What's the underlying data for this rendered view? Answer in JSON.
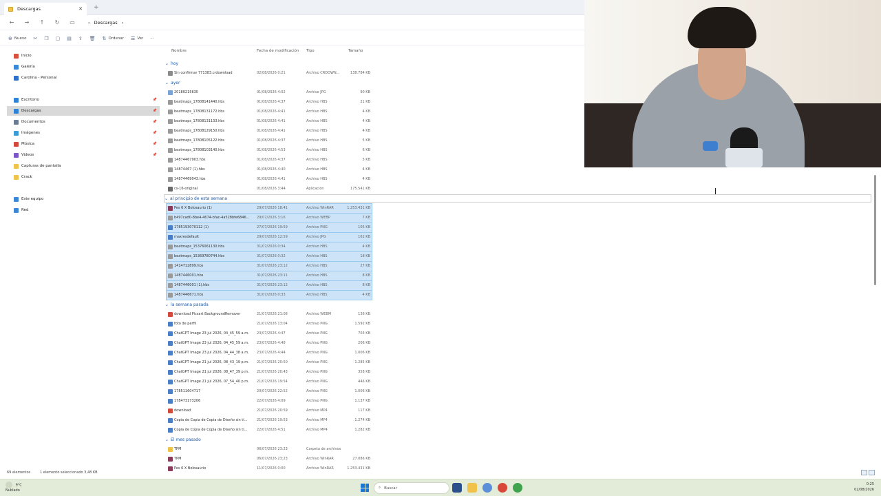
{
  "tab": {
    "title": "Descargas"
  },
  "address": {
    "location": "Descargas",
    "chevron": "›"
  },
  "toolbar": {
    "new_label": "Nuevo",
    "sort_label": "Ordenar",
    "view_label": "Ver",
    "more_label": "···"
  },
  "sidebar": {
    "items": [
      {
        "label": "Inicio",
        "color": "#d94f3d"
      },
      {
        "label": "Galería",
        "color": "#3a88d8"
      },
      {
        "label": "Carolina - Personal",
        "color": "#2f6fc8"
      },
      {
        "label": "Escritorio",
        "color": "#2f82d6"
      },
      {
        "label": "Descargas",
        "color": "#2f82d6"
      },
      {
        "label": "Documentos",
        "color": "#6b7c95"
      },
      {
        "label": "Imágenes",
        "color": "#3a9bd8"
      },
      {
        "label": "Música",
        "color": "#d2483b"
      },
      {
        "label": "Videos",
        "color": "#7b57c9"
      },
      {
        "label": "Capturas de pantalla",
        "color": "#f0c24a"
      },
      {
        "label": "Crack",
        "color": "#f0c24a"
      },
      {
        "label": "Este equipo",
        "color": "#3a88d8"
      },
      {
        "label": "Red",
        "color": "#3a88d8"
      }
    ]
  },
  "columns": {
    "name": "Nombre",
    "date": "Fecha de modificación",
    "type": "Tipo",
    "size": "Tamaño"
  },
  "groups": [
    {
      "label": "hoy",
      "rows": [
        {
          "name": "Sin confirmar 771383.crdownload",
          "date": "02/08/2026 0:21",
          "type": "Archivo CRDOWN...",
          "size": "138.784 KB",
          "icon": "#8a8a8a"
        }
      ]
    },
    {
      "label": "ayer",
      "rows": [
        {
          "name": "20180215630",
          "date": "01/08/2026 4:02",
          "type": "Archivo JPG",
          "size": "90 KB",
          "icon": "#7aa3d8"
        },
        {
          "name": "beatmaps_17808141440.hbs",
          "date": "01/08/2026 4:37",
          "type": "Archivo HBS",
          "size": "21 KB",
          "icon": "#9a9a9a"
        },
        {
          "name": "beatmaps_17808131172.hbs",
          "date": "01/08/2026 4:41",
          "type": "Archivo HBS",
          "size": "4 KB",
          "icon": "#9a9a9a"
        },
        {
          "name": "beatmaps_17808131133.hbs",
          "date": "01/08/2026 4:41",
          "type": "Archivo HBS",
          "size": "4 KB",
          "icon": "#9a9a9a"
        },
        {
          "name": "beatmaps_17808129150.hbs",
          "date": "01/08/2026 4:41",
          "type": "Archivo HBS",
          "size": "4 KB",
          "icon": "#9a9a9a"
        },
        {
          "name": "beatmaps_17808105122.hbs",
          "date": "01/08/2026 4:37",
          "type": "Archivo HBS",
          "size": "5 KB",
          "icon": "#9a9a9a"
        },
        {
          "name": "beatmaps_17808103140.hbs",
          "date": "01/08/2026 4:53",
          "type": "Archivo HBS",
          "size": "6 KB",
          "icon": "#9a9a9a"
        },
        {
          "name": "14874467903.hbs",
          "date": "01/08/2026 4:37",
          "type": "Archivo HBS",
          "size": "5 KB",
          "icon": "#9a9a9a"
        },
        {
          "name": "14874467 (1).hbs",
          "date": "01/08/2026 4:40",
          "type": "Archivo HBS",
          "size": "4 KB",
          "icon": "#9a9a9a"
        },
        {
          "name": "14874469043.hbs",
          "date": "01/08/2026 4:41",
          "type": "Archivo HBS",
          "size": "4 KB",
          "icon": "#9a9a9a"
        },
        {
          "name": "cs-16-original",
          "date": "01/08/2026 3:44",
          "type": "Aplicación",
          "size": "175.541 KB",
          "icon": "#6a6a6a"
        }
      ]
    },
    {
      "label": "al principio de esta semana",
      "selected": true,
      "rows": [
        {
          "name": "Pes 6 X Bolosaurio (1)",
          "date": "29/07/2026 18:41",
          "type": "Archivo WinRAR",
          "size": "1.253.431 KB",
          "icon": "#8b3a5a"
        },
        {
          "name": "b497cad0-8be4-4674-bfac-4a528bfe6846...",
          "date": "29/07/2026 3:16",
          "type": "Archivo WEBP",
          "size": "7 KB",
          "icon": "#9a9a9a"
        },
        {
          "name": "1785193070112 (1)",
          "date": "27/07/2026 19:59",
          "type": "Archivo PNG",
          "size": "105 KB",
          "icon": "#4a7fc8"
        },
        {
          "name": "maxresdefault",
          "date": "29/07/2026 12:59",
          "type": "Archivo JPG",
          "size": "161 KB",
          "icon": "#4a7fc8"
        },
        {
          "name": "beatmaps_15376061130.hbs",
          "date": "31/07/2026 0:34",
          "type": "Archivo HBS",
          "size": "4 KB",
          "icon": "#9a9a9a"
        },
        {
          "name": "beatmaps_15369780744.hbs",
          "date": "31/07/2026 0:32",
          "type": "Archivo HBS",
          "size": "18 KB",
          "icon": "#9a9a9a"
        },
        {
          "name": "1414712899.hbs",
          "date": "31/07/2026 23:12",
          "type": "Archivo HBS",
          "size": "27 KB",
          "icon": "#9a9a9a"
        },
        {
          "name": "1487446001.hbs",
          "date": "31/07/2026 23:11",
          "type": "Archivo HBS",
          "size": "8 KB",
          "icon": "#9a9a9a"
        },
        {
          "name": "1487446001 (1).hbs",
          "date": "31/07/2026 23:12",
          "type": "Archivo HBS",
          "size": "8 KB",
          "icon": "#9a9a9a"
        },
        {
          "name": "1487446671.hbs",
          "date": "31/07/2026 0:33",
          "type": "Archivo HBS",
          "size": "4 KB",
          "icon": "#9a9a9a"
        }
      ]
    },
    {
      "label": "la semana pasada",
      "rows": [
        {
          "name": "download Picsart BackgroundRemover",
          "date": "21/07/2026 21:08",
          "type": "Archivo WEBM",
          "size": "136 KB",
          "icon": "#d24a3a"
        },
        {
          "name": "foto de perfil",
          "date": "21/07/2026 13:04",
          "type": "Archivo PNG",
          "size": "1.592 KB",
          "icon": "#4a7fc8"
        },
        {
          "name": "ChatGPT Image 23 jul 2026, 04_45_59 a.m.",
          "date": "23/07/2026 4:47",
          "type": "Archivo PNG",
          "size": "703 KB",
          "icon": "#4a7fc8"
        },
        {
          "name": "ChatGPT Image 23 jul 2026, 04_45_59 a.m.",
          "date": "23/07/2026 4:48",
          "type": "Archivo PNG",
          "size": "206 KB",
          "icon": "#4a7fc8"
        },
        {
          "name": "ChatGPT Image 23 jul 2026, 04_44_38 a.m.",
          "date": "23/07/2026 4:44",
          "type": "Archivo PNG",
          "size": "1.006 KB",
          "icon": "#4a7fc8"
        },
        {
          "name": "ChatGPT Image 21 jul 2026, 08_43_19 p.m.",
          "date": "21/07/2026 20:50",
          "type": "Archivo PNG",
          "size": "1.285 KB",
          "icon": "#4a7fc8"
        },
        {
          "name": "ChatGPT Image 21 jul 2026, 08_47_39 p.m.",
          "date": "21/07/2026 20:43",
          "type": "Archivo PNG",
          "size": "358 KB",
          "icon": "#4a7fc8"
        },
        {
          "name": "ChatGPT Image 21 jul 2026, 07_54_40 p.m.",
          "date": "21/07/2026 19:54",
          "type": "Archivo PNG",
          "size": "446 KB",
          "icon": "#4a7fc8"
        },
        {
          "name": "178511604717",
          "date": "20/07/2026 22:52",
          "type": "Archivo PNG",
          "size": "1.006 KB",
          "icon": "#4a7fc8"
        },
        {
          "name": "178473173206",
          "date": "22/07/2026 4:09",
          "type": "Archivo PNG",
          "size": "1.137 KB",
          "icon": "#4a7fc8"
        },
        {
          "name": "download",
          "date": "21/07/2026 20:59",
          "type": "Archivo MP4",
          "size": "117 KB",
          "icon": "#d24a3a"
        },
        {
          "name": "Copia de Copia de Copia de Diseño sin tí...",
          "date": "21/07/2026 19:53",
          "type": "Archivo MP4",
          "size": "1.274 KB",
          "icon": "#4a7fc8"
        },
        {
          "name": "Copia de Copia de Copia de Diseño sin tí...",
          "date": "22/07/2026 4:51",
          "type": "Archivo MP4",
          "size": "1.282 KB",
          "icon": "#4a7fc8"
        }
      ]
    },
    {
      "label": "El mes pasado",
      "rows": [
        {
          "name": "TPM",
          "date": "06/07/2026 23:23",
          "type": "Carpeta de archivos",
          "size": "",
          "icon": "#f0c24a"
        },
        {
          "name": "TPM",
          "date": "06/07/2026 23:23",
          "type": "Archivo WinRAR",
          "size": "27.086 KB",
          "icon": "#8b3a5a"
        },
        {
          "name": "Pes 6 X Bolosaurio",
          "date": "11/07/2026 0:00",
          "type": "Archivo WinRAR",
          "size": "1.253.431 KB",
          "icon": "#8b3a5a"
        }
      ]
    }
  ],
  "status": {
    "count": "69 elementos",
    "selection": "1 elemento seleccionado  3,48 KB"
  },
  "taskbar": {
    "temp": "9°C",
    "weather": "Nublado",
    "search_placeholder": "Buscar",
    "time": "0:25",
    "date": "02/08/2026"
  }
}
